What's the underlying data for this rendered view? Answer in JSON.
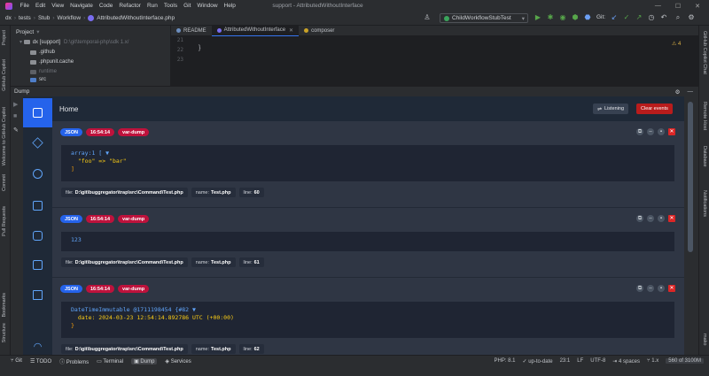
{
  "menubar": {
    "items": [
      "File",
      "Edit",
      "View",
      "Navigate",
      "Code",
      "Refactor",
      "Run",
      "Tools",
      "Git",
      "Window",
      "Help"
    ],
    "window_title": "support - AttributedWithoutInterface"
  },
  "navbar": {
    "crumbs": [
      "dx",
      "tests",
      "Stub",
      "Workflow",
      "AttributedWithoutInterface.php"
    ],
    "run_config": "ChildWorkflowStubTest",
    "git_label": "Git:"
  },
  "left_strip": {
    "top_labels": [
      "Project",
      "GitHub Copilot",
      "Welcome to GitHub Copilot",
      "Commit",
      "Pull Requests"
    ],
    "bottom_labels": [
      "Bookmarks",
      "Structure"
    ]
  },
  "right_strip": {
    "labels": [
      "GitHub Copilot Chat",
      "Remote Host",
      "Database",
      "Notifications",
      "mako"
    ]
  },
  "project_panel": {
    "title": "Project",
    "root": "dx [support]",
    "root_path": "D:\\git\\temporal-php\\sdk 1.x/",
    "items": [
      ".github",
      ".phpunit.cache",
      "runtime",
      "src"
    ]
  },
  "editor": {
    "tabs": [
      "README",
      "AttributedWithoutInterface",
      "composer"
    ],
    "line_numbers": [
      "21",
      "22",
      "23"
    ],
    "warnings": "4"
  },
  "dump_window": {
    "title": "Dump"
  },
  "app": {
    "header_title": "Home",
    "listening_label": "Listening",
    "clear_label": "Clear events",
    "events": [
      {
        "format": "JSON",
        "time": "16:54:14",
        "type": "var-dump",
        "body_lines": [
          {
            "t": "array:1 [",
            "c": "c-blue",
            "extra": "▼"
          },
          {
            "t": "  \"foo\" => \"bar\"",
            "c": "c-yellow"
          },
          {
            "t": "]",
            "c": "c-orange"
          }
        ],
        "file_label": "file:",
        "file": "D:\\git\\buggregator\\trap\\src\\Command\\Test.php",
        "name_label": "name:",
        "name": "Test.php",
        "line_label": "line:",
        "line": "60"
      },
      {
        "format": "JSON",
        "time": "16:54:14",
        "type": "var-dump",
        "body_lines": [
          {
            "t": "123",
            "c": "c-blue"
          }
        ],
        "file_label": "file:",
        "file": "D:\\git\\buggregator\\trap\\src\\Command\\Test.php",
        "name_label": "name:",
        "name": "Test.php",
        "line_label": "line:",
        "line": "61"
      },
      {
        "format": "JSON",
        "time": "16:54:14",
        "type": "var-dump",
        "body_lines": [
          {
            "t": "DateTimeImmutable @1711198454 {#82 ▼",
            "c": "c-blue"
          },
          {
            "t": "  date: 2024-03-23 12:54:14.892786 UTC (+00:00)",
            "c": "c-yellow"
          },
          {
            "t": "}",
            "c": "c-orange"
          }
        ],
        "file_label": "file:",
        "file": "D:\\git\\buggregator\\trap\\src\\Command\\Test.php",
        "name_label": "name:",
        "name": "Test.php",
        "line_label": "line:",
        "line": "62"
      }
    ]
  },
  "statusbar": {
    "tools": [
      "Git",
      "TODO",
      "Problems",
      "Terminal",
      "Dump",
      "Services"
    ],
    "active_tool": "Dump",
    "right": [
      "PHP: 8.1",
      "up-to-date",
      "23:1",
      "LF",
      "UTF-8",
      "4 spaces",
      "1.x"
    ],
    "memory": "560 of 3100M"
  }
}
